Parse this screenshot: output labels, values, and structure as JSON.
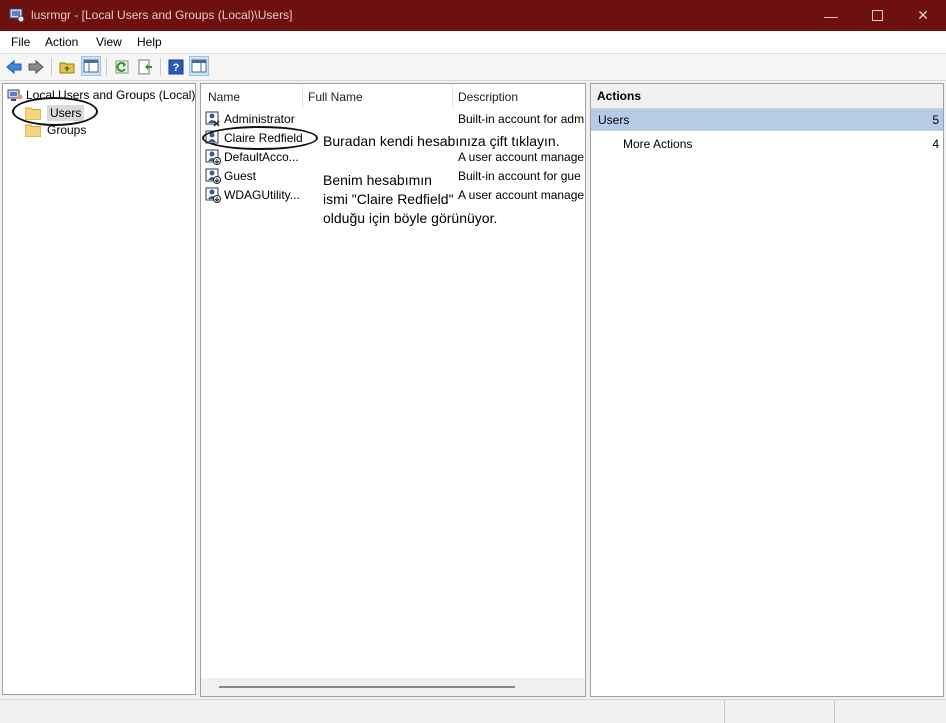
{
  "window": {
    "title": "lusrmgr - [Local Users and Groups (Local)\\Users]"
  },
  "menu": {
    "file": "File",
    "action": "Action",
    "view": "View",
    "help": "Help"
  },
  "toolbar_icons": [
    "back-icon",
    "forward-icon",
    "up-folder-icon",
    "show-hide-tree-icon",
    "refresh-icon",
    "export-list-icon",
    "help-icon",
    "show-hide-action-pane-icon"
  ],
  "tree": {
    "root": "Local Users and Groups (Local)",
    "users": "Users",
    "groups": "Groups"
  },
  "list": {
    "columns": {
      "name": "Name",
      "full_name": "Full Name",
      "description": "Description"
    },
    "rows": [
      {
        "name": "Administrator",
        "full_name": "",
        "description": "Built-in account for adm"
      },
      {
        "name": "Claire Redfield",
        "full_name": "",
        "description": ""
      },
      {
        "name": "DefaultAcco...",
        "full_name": "",
        "description": "A user account manage"
      },
      {
        "name": "Guest",
        "full_name": "",
        "description": "Built-in account for gue"
      },
      {
        "name": "WDAGUtility...",
        "full_name": "",
        "description": "A user account manage"
      }
    ]
  },
  "annotations": {
    "note1": "Buradan kendi hesabınıza çift tıklayın.",
    "note2_line1": "Benim hesabımın",
    "note2_line2": "ismi \"Claire Redfield\"",
    "note2_line3": "olduğu için böyle görünüyor."
  },
  "actions": {
    "header": "Actions",
    "selected": {
      "label": "Users",
      "count": "5"
    },
    "more": {
      "label": "More Actions",
      "count": "4"
    }
  },
  "colors": {
    "titlebar": "#6e0f10",
    "selection": "#b6cce6"
  }
}
